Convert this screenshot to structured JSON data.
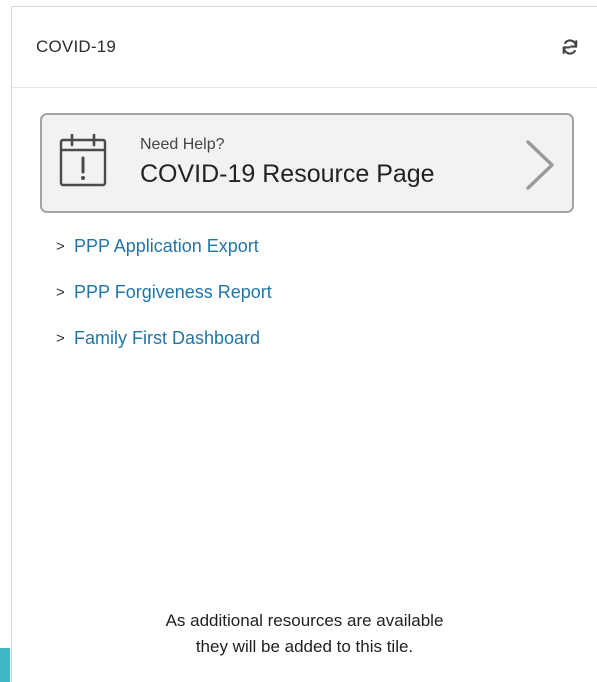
{
  "tile": {
    "title": "COVID-19",
    "refresh_icon": "refresh-icon"
  },
  "resource_card": {
    "eyebrow": "Need Help?",
    "title": "COVID-19 Resource Page",
    "icon": "calendar-alert-icon",
    "arrow_icon": "chevron-right-icon"
  },
  "links": [
    {
      "caret": ">",
      "label": "PPP Application Export"
    },
    {
      "caret": ">",
      "label": "PPP Forgiveness Report"
    },
    {
      "caret": ">",
      "label": "Family First Dashboard"
    }
  ],
  "footer": {
    "line1": "As additional resources are available",
    "line2": "they will be added to this tile."
  },
  "colors": {
    "link": "#2176a8",
    "accent": "#41b8c6",
    "card_bg": "#f2f2f2",
    "card_border": "#a4a4a4"
  }
}
